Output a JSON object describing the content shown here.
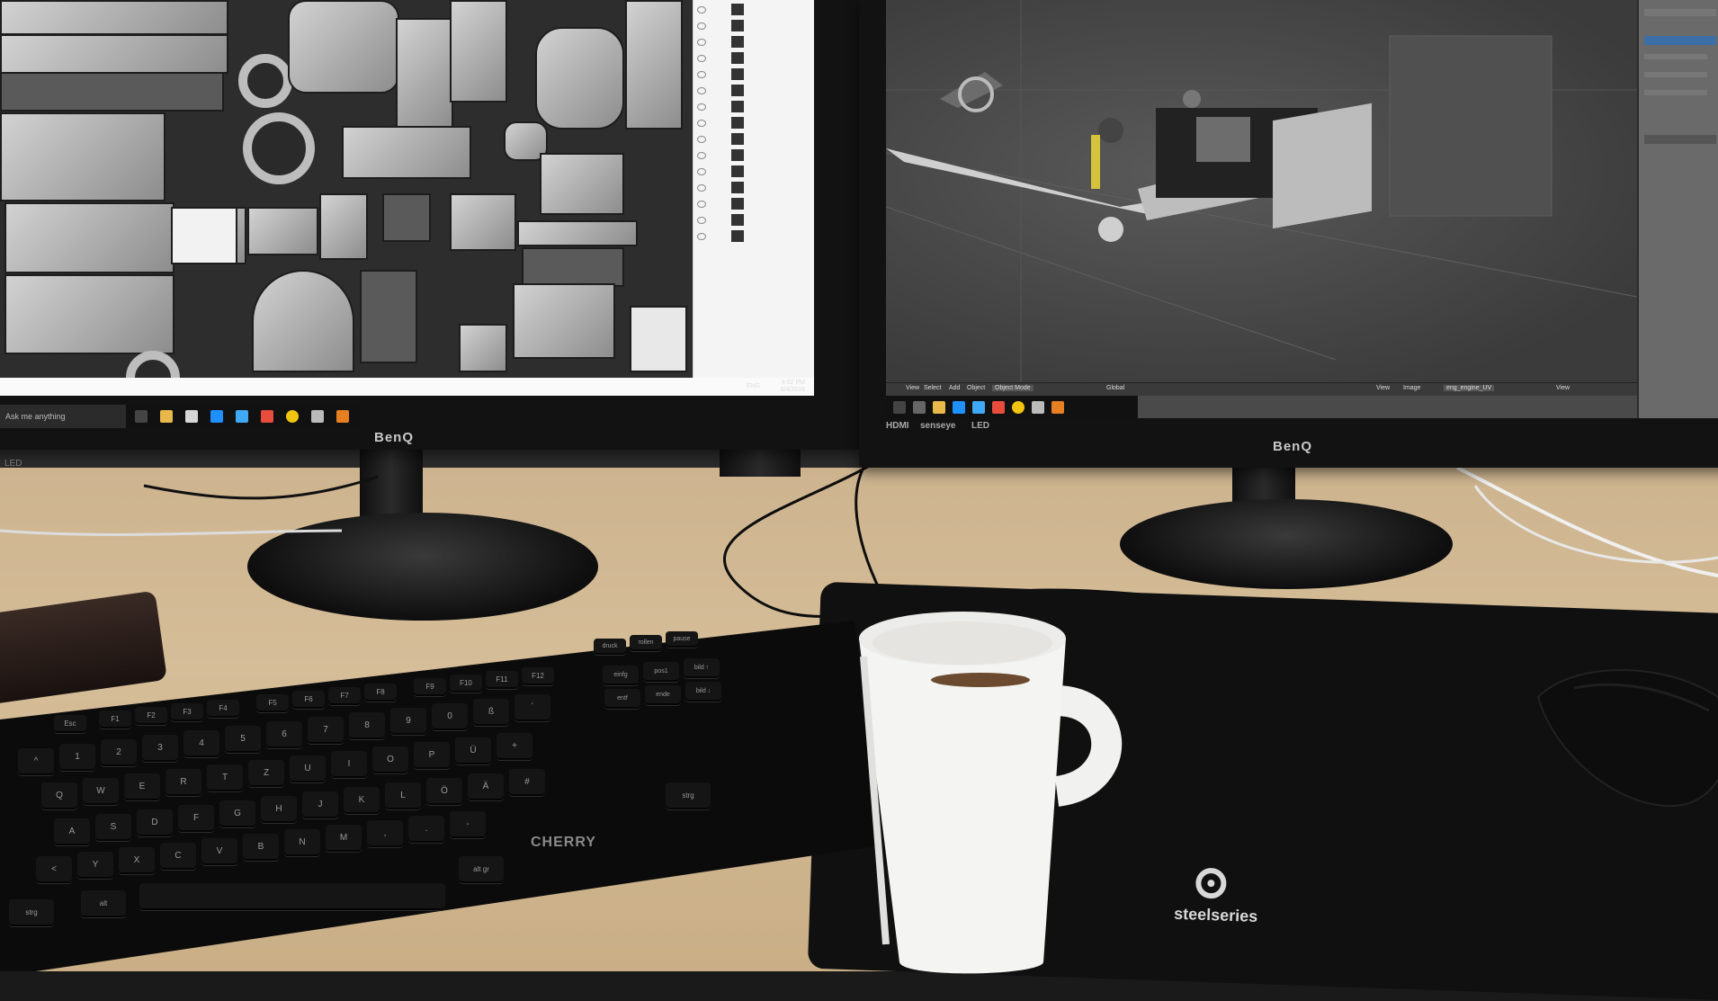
{
  "scene": {
    "left_monitor": {
      "brand": "BenQ",
      "side_label": "LED",
      "search_placeholder": "Ask me anything",
      "clock_time": "4:02 PM",
      "clock_date": "6/4/2016",
      "tray_label": "ENG"
    },
    "right_monitor": {
      "brand": "BenQ",
      "hdmi_label": "HDMI",
      "senseye_label": "senseye",
      "led_label": "LED",
      "blender_header": {
        "menu_view": "View",
        "menu_select": "Select",
        "menu_add": "Add",
        "menu_object": "Object",
        "mode": "Object Mode",
        "orientation": "Global",
        "uv_menu_view": "View",
        "uv_menu_image": "Image",
        "image_name": "eng_engine_UV",
        "view_btn": "View"
      }
    },
    "keyboard": {
      "brand": "CHERRY",
      "keys_row_f": [
        "Esc",
        "F1",
        "F2",
        "F3",
        "F4",
        "F5",
        "F6",
        "F7",
        "F8",
        "F9",
        "F10",
        "F11",
        "F12"
      ],
      "keys_row_num": [
        "^",
        "1",
        "2",
        "3",
        "4",
        "5",
        "6",
        "7",
        "8",
        "9",
        "0",
        "ß",
        "´"
      ],
      "keys_row_q": [
        "Q",
        "W",
        "E",
        "R",
        "T",
        "Z",
        "U",
        "I",
        "O",
        "P",
        "Ü",
        "+"
      ],
      "keys_row_a": [
        "A",
        "S",
        "D",
        "F",
        "G",
        "H",
        "J",
        "K",
        "L",
        "Ö",
        "Ä",
        "#"
      ],
      "keys_row_y": [
        "<",
        "Y",
        "X",
        "C",
        "V",
        "B",
        "N",
        "M",
        ",",
        ".",
        "-"
      ],
      "nav_keys": [
        "druck",
        "rollen",
        "pause",
        "einfg",
        "pos1",
        "bild ↑",
        "entf",
        "ende",
        "bild ↓"
      ],
      "mod_keys": [
        "strg",
        "alt",
        "alt gr",
        "strg"
      ]
    },
    "mousepad": {
      "brand": "steelseries"
    },
    "colors": {
      "desk": "#d2b993",
      "monitor_bezel": "#121212",
      "mug": "#f4f4f2",
      "coffee": "#6b4a2f"
    }
  }
}
